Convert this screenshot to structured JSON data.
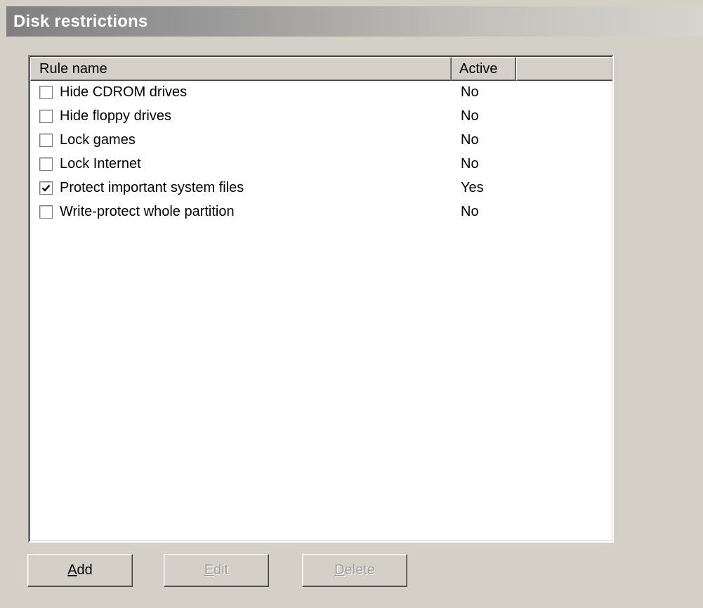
{
  "header": {
    "title": "Disk restrictions"
  },
  "list": {
    "columns": {
      "rule_name": "Rule name",
      "active": "Active"
    },
    "rows": [
      {
        "name": "Hide CDROM drives",
        "active": "No",
        "checked": false
      },
      {
        "name": "Hide floppy drives",
        "active": "No",
        "checked": false
      },
      {
        "name": "Lock games",
        "active": "No",
        "checked": false
      },
      {
        "name": "Lock Internet",
        "active": "No",
        "checked": false
      },
      {
        "name": "Protect important system files",
        "active": "Yes",
        "checked": true
      },
      {
        "name": "Write-protect whole partition",
        "active": "No",
        "checked": false
      }
    ]
  },
  "buttons": {
    "add": {
      "mnemonic": "A",
      "rest": "dd",
      "enabled": true
    },
    "edit": {
      "mnemonic": "E",
      "rest": "dit",
      "enabled": false
    },
    "delete": {
      "mnemonic": "D",
      "rest": "elete",
      "enabled": false
    }
  },
  "icons": {
    "checkmark": "checkmark-icon"
  }
}
